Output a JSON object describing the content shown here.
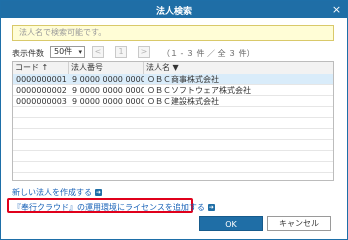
{
  "window": {
    "title": "法人検索",
    "close_glyph": "×"
  },
  "search": {
    "placeholder": "法人名で検索可能です。"
  },
  "pager": {
    "count_label": "表示件数",
    "count_value": "50件",
    "page_number": "1",
    "page_info": "（１ - ３ 件 ／ 全 ３ 件）"
  },
  "table": {
    "headers": [
      "コード ↑",
      "法人番号",
      "法人名 ▼"
    ],
    "rows": [
      [
        "0000000001",
        "9 0000 0000 0000",
        "ＯＢＣ商事株式会社"
      ],
      [
        "0000000002",
        "9 0000 0000 0000",
        "ＯＢＣソフトウェア株式会社"
      ],
      [
        "0000000003",
        "9 0000 0000 0000",
        "ＯＢＣ建設株式会社"
      ]
    ]
  },
  "links": {
    "new_corp": "新しい法人を作成する",
    "add_license": "『奉行クラウド』の運用環境にライセンスを追加する"
  },
  "buttons": {
    "ok": "OK",
    "cancel": "キャンセル"
  },
  "colors": {
    "accent": "#1f6ea6",
    "highlight_border": "#e0001b",
    "search_bg": "#fffdd6",
    "selected_row": "#d9ecfa"
  }
}
